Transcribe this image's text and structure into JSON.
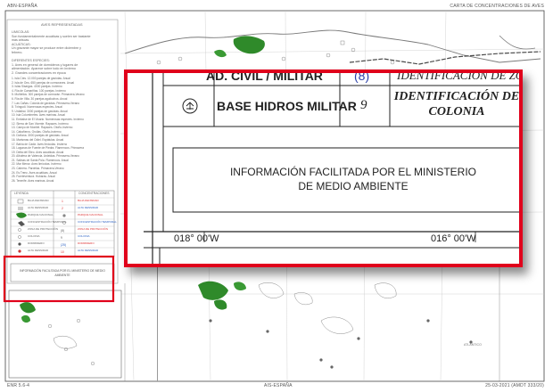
{
  "header": {
    "left": "ABN-ESPAÑA",
    "right": "CARTA DE CONCENTRACIONES DE AVES"
  },
  "footer": {
    "left": "ENR 5.6-4",
    "center": "AIS-ESPAÑA",
    "right": "25-03-2021 (AMDT 333/20)"
  },
  "legend_sidebar": {
    "title": "AVES REPRESENTADAS",
    "lines_a": [
      "LIMICOLAS:",
      "Son fundamentalmente acuáticas y suelen ser bastante",
      "más ariscas.",
      "ACUÁTICAS:",
      "Un gravante mayor se produce entre diciembre y",
      "febrero."
    ],
    "lines_b": [
      "DIFERENTES ESPECIES:",
      "1. Aves en general de dormideros y lugares de",
      "alimentación. Aparece sobre todo en invierno",
      "2. Grandes concentraciones en época"
    ],
    "species": [
      "1. Isla Cíes. 12.000 parejas de gaviotas. Anual",
      "2. Isla de Ons. 650 parejas de cormoranes. Anual",
      "3. Islas Sisargas. 4000 parejas. Invierno",
      "4. Ría de Camariñas. 100 parejas. Invierno",
      "5. Muñiellos. 300 parejas de cormorán. Primavera-Verano",
      "6. Ría de Villa. 30 parejas aguiluchos. Anual",
      "7. Las Cañas. Colonia de gaviotas. Primavera-Verano",
      "8. Txingudi. Numerosas especies. Anual",
      "9. Urdaibai. 3000 parejas de gaviotas. Anual",
      "10. Isla Columbretes. Aves marinas. Anual",
      "11. Embalse de El Vicario. Numerosas especies. Invierno",
      "12. Sierra de San Vicente. Rapaces. Invierno",
      "13. Campo de Montiel. Rapaces. Otoño-Invierno",
      "14. Cabañeros. Grullas. Otoño-Invierno",
      "15. Doñana. 3000 parejas de gaviotas. Anual",
      "16. Marismas del Odiel. Espátulas. Anual",
      "17. Bahía de Cádiz. Aves limícolas. Invierno",
      "18. Lagunas de Fuente de Piedra. Flamencos. Primavera",
      "19. Delta del Ebro. Aves acuáticas. Anual",
      "20. Albufera de Valencia. Ardeidas. Primavera-Verano",
      "21. Salinas de Santa Pola. Flamencos. Anual",
      "22. Mar Menor. Aves limícolas. Invierno",
      "23. Cabrera. Pardelas. Primavera-Verano",
      "24. Es Trenc. Aves acuáticas. Anual",
      "25. Fuerteventura. Hubaras. Anual",
      "26. Tenerife. Aves marinas. Anual"
    ],
    "table_head": [
      "LEYENDA",
      "CONCENTRACIONES"
    ],
    "table_rows": [
      "BAJA DENSIDAD",
      "ALTA DENSIDAD",
      "PARQUE NACIONAL",
      "CONCENTRACIÓN TEMPORAL",
      "ZONA DE PROTECCIÓN",
      "COLONIA",
      "DORMIDERO",
      "ALTA DENSIDAD"
    ],
    "info_small": "INFORMACIÓN FACILITADA POR EL MINISTERIO DE MEDIO AMBIENTE"
  },
  "zoom": {
    "row_top_label": "AD. CIVIL / MILITAR",
    "row_top_number": "(8)",
    "row_top_right": "IDENTIFICACIÓN DE ZONA",
    "base_label": "BASE HIDROS MILITAR",
    "base_number": "9",
    "ident_line1": "IDENTIFICACIÓN DE",
    "ident_line2": "COLONIA",
    "info_line1": "INFORMACIÓN FACILITADA POR EL MINISTERIO",
    "info_line2": "DE MEDIO AMBIENTE",
    "lon_left": "018° 00'W",
    "lon_right": "016° 00'W"
  },
  "colors": {
    "highlight": "#e0001b",
    "map_line": "#9a9a9a",
    "land_green": "#2f8a2a",
    "frame": "#333333"
  }
}
